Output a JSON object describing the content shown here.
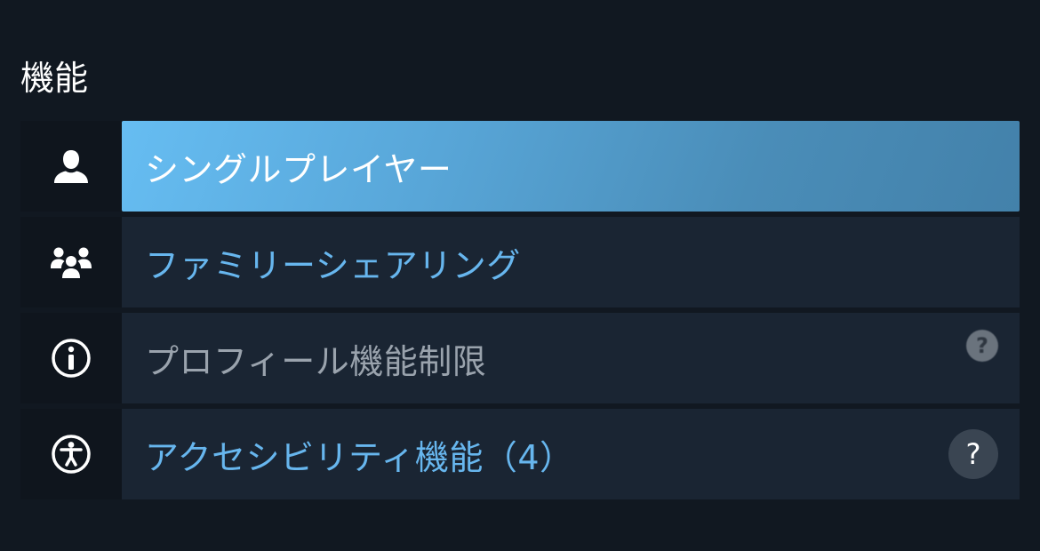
{
  "section": {
    "title": "機能"
  },
  "features": [
    {
      "label": "シングルプレイヤー",
      "icon": "single-player-icon",
      "selected": true
    },
    {
      "label": "ファミリーシェアリング",
      "icon": "family-sharing-icon",
      "selected": false
    },
    {
      "label": "プロフィール機能制限",
      "icon": "info-icon",
      "selected": false,
      "help": "?"
    },
    {
      "label": "アクセシビリティ機能（4）",
      "icon": "accessibility-icon",
      "selected": false,
      "help": "?"
    }
  ],
  "colors": {
    "background": "#111821",
    "row_background": "#1a2533",
    "icon_cell_background": "#0f151d",
    "accent_text": "#67b6ee",
    "selected_gradient_start": "#66bdf2",
    "selected_gradient_end": "#4381aa",
    "dim_text": "#9aa3ad"
  }
}
